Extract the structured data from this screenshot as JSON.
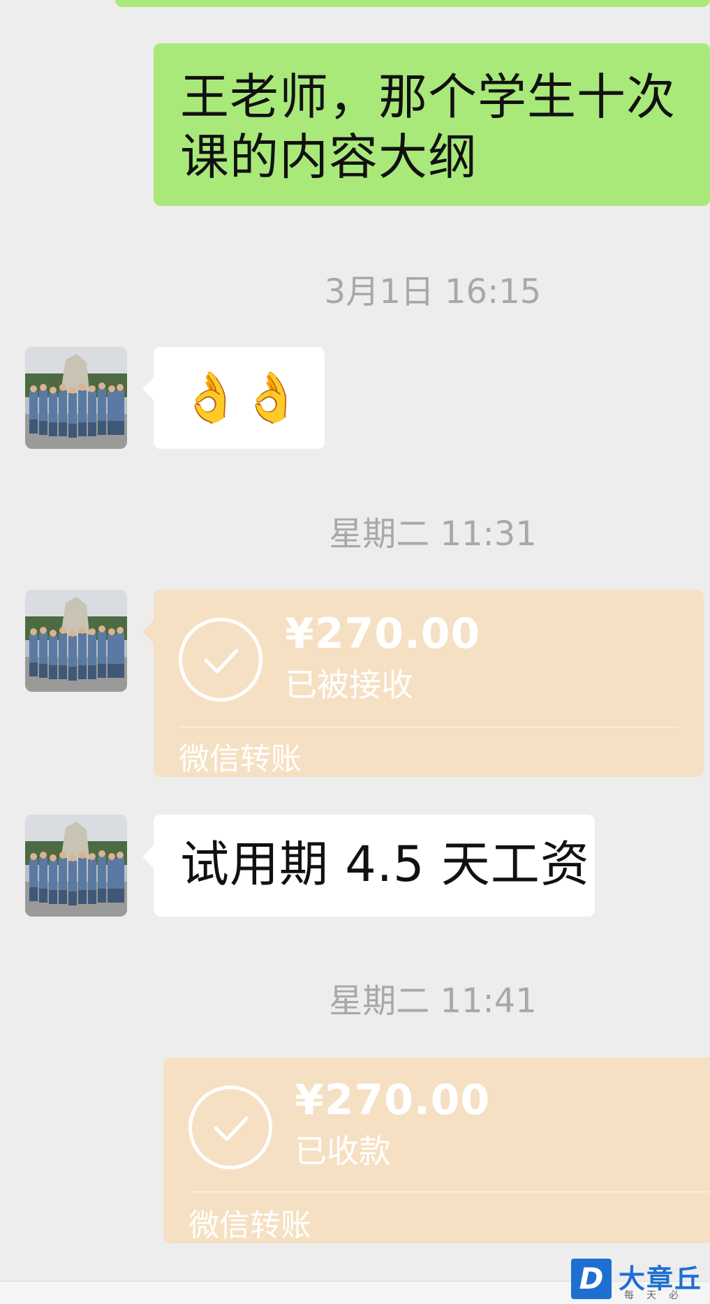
{
  "messages": {
    "m1_text": "王老师，那个学生十次课的内容大纲",
    "ts1": "3月1日 16:15",
    "m2_emoji": "👌👌",
    "ts2": "星期二 11:31",
    "transfer1": {
      "amount": "¥270.00",
      "status": "已被接收",
      "label": "微信转账"
    },
    "m3_text": "试用期 4.5 天工资",
    "ts3": "星期二 11:41",
    "transfer2": {
      "amount": "¥270.00",
      "status": "已收款",
      "label": "微信转账"
    }
  },
  "watermark": {
    "mark": "D",
    "name": "大章丘",
    "sub": "每天必看"
  },
  "colors": {
    "outgoing_bubble": "#a9e97a",
    "incoming_bubble": "#ffffff",
    "transfer_bubble": "#f6e0c3",
    "background": "#ededed",
    "timestamp": "#a8a8a8",
    "watermark_blue": "#1f6fd1"
  },
  "icons": {
    "check": "check-circle-icon",
    "avatar": "group-photo-avatar"
  }
}
